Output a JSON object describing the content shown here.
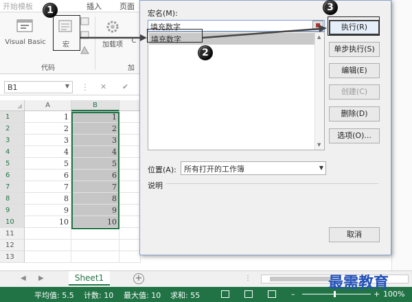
{
  "ribbon": {
    "tab_fragments": [
      "开始模板",
      "插入",
      "页面"
    ],
    "visual_basic_label": "Visual Basic",
    "macros_label": "宏",
    "addins_label": "加载项",
    "addins_fragment": "C",
    "group_code_label": "代码",
    "group_addins_label": "加"
  },
  "formula_bar": {
    "namebox_value": "B1",
    "cancel_symbol": "✕",
    "enter_symbol": "✔"
  },
  "sheet": {
    "columns": [
      "A",
      "B"
    ],
    "rows": [
      {
        "num": "1",
        "a": "1",
        "b": "1"
      },
      {
        "num": "2",
        "a": "2",
        "b": "2"
      },
      {
        "num": "3",
        "a": "3",
        "b": "3"
      },
      {
        "num": "4",
        "a": "4",
        "b": "4"
      },
      {
        "num": "5",
        "a": "5",
        "b": "5"
      },
      {
        "num": "6",
        "a": "6",
        "b": "6"
      },
      {
        "num": "7",
        "a": "7",
        "b": "7"
      },
      {
        "num": "8",
        "a": "8",
        "b": "8"
      },
      {
        "num": "9",
        "a": "9",
        "b": "9"
      },
      {
        "num": "10",
        "a": "10",
        "b": "10"
      },
      {
        "num": "11",
        "a": "",
        "b": ""
      },
      {
        "num": "12",
        "a": "",
        "b": ""
      },
      {
        "num": "13",
        "a": "",
        "b": ""
      }
    ],
    "tab_label": "Sheet1",
    "add_sheet_symbol": "+"
  },
  "status": {
    "average": "平均值: 5.5",
    "count": "计数: 10",
    "max": "最大值: 10",
    "sum": "求和: 55",
    "zoom": "100%"
  },
  "dialog": {
    "macro_name_label": "宏名(M):",
    "macro_name_value": "填充数字",
    "macro_list": [
      "填充数字"
    ],
    "buttons": {
      "run": "执行(R)",
      "step_into": "单步执行(S)",
      "edit": "编辑(E)",
      "create": "创建(C)",
      "delete": "删除(D)",
      "options": "选项(O)...",
      "cancel": "取消"
    },
    "location_label": "位置(A):",
    "location_value": "所有打开的工作簿",
    "description_label": "说明"
  },
  "callouts": {
    "one": "1",
    "two": "2",
    "three": "3"
  },
  "watermark": "最需教育",
  "colors": {
    "excel_green": "#217346",
    "selection_gray": "#c6c6c6",
    "dialog_bg": "#f0f0f0"
  }
}
